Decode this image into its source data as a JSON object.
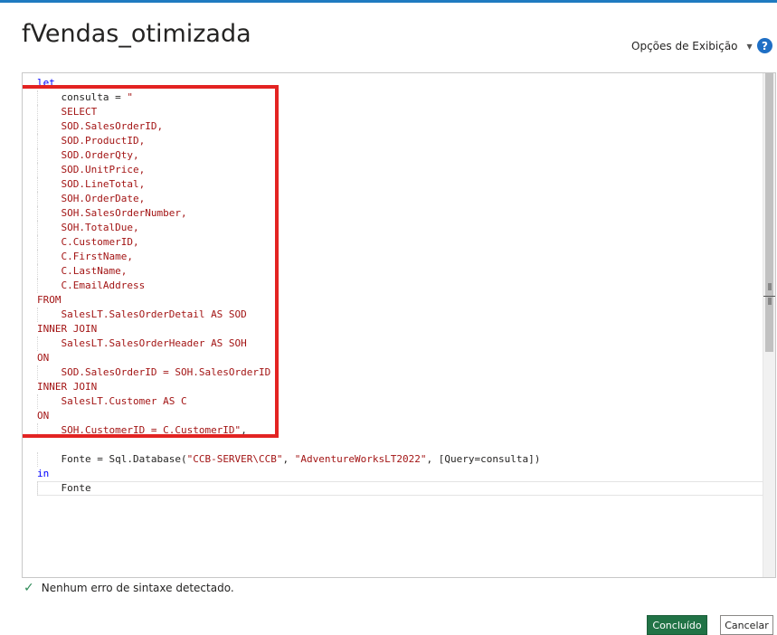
{
  "header": {
    "title": "fVendas_otimizada",
    "view_options_label": "Opções de Exibição",
    "help_label": "?"
  },
  "editor": {
    "lines": [
      {
        "indent": 0,
        "parts": [
          {
            "t": "kw",
            "v": "let"
          }
        ]
      },
      {
        "indent": 1,
        "parts": [
          {
            "t": "tx",
            "v": "consulta = "
          },
          {
            "t": "str",
            "v": "\""
          }
        ]
      },
      {
        "indent": 1,
        "parts": [
          {
            "t": "str",
            "v": "SELECT"
          }
        ]
      },
      {
        "indent": 1,
        "parts": [
          {
            "t": "str",
            "v": "SOD.SalesOrderID,"
          }
        ]
      },
      {
        "indent": 1,
        "parts": [
          {
            "t": "str",
            "v": "SOD.ProductID,"
          }
        ]
      },
      {
        "indent": 1,
        "parts": [
          {
            "t": "str",
            "v": "SOD.OrderQty,"
          }
        ]
      },
      {
        "indent": 1,
        "parts": [
          {
            "t": "str",
            "v": "SOD.UnitPrice,"
          }
        ]
      },
      {
        "indent": 1,
        "parts": [
          {
            "t": "str",
            "v": "SOD.LineTotal,"
          }
        ]
      },
      {
        "indent": 1,
        "parts": [
          {
            "t": "str",
            "v": "SOH.OrderDate,"
          }
        ]
      },
      {
        "indent": 1,
        "parts": [
          {
            "t": "str",
            "v": "SOH.SalesOrderNumber,"
          }
        ]
      },
      {
        "indent": 1,
        "parts": [
          {
            "t": "str",
            "v": "SOH.TotalDue,"
          }
        ]
      },
      {
        "indent": 1,
        "parts": [
          {
            "t": "str",
            "v": "C.CustomerID,"
          }
        ]
      },
      {
        "indent": 1,
        "parts": [
          {
            "t": "str",
            "v": "C.FirstName,"
          }
        ]
      },
      {
        "indent": 1,
        "parts": [
          {
            "t": "str",
            "v": "C.LastName,"
          }
        ]
      },
      {
        "indent": 1,
        "parts": [
          {
            "t": "str",
            "v": "C.EmailAddress"
          }
        ]
      },
      {
        "indent": 0,
        "parts": [
          {
            "t": "str",
            "v": "FROM"
          }
        ]
      },
      {
        "indent": 1,
        "parts": [
          {
            "t": "str",
            "v": "SalesLT.SalesOrderDetail AS SOD"
          }
        ]
      },
      {
        "indent": 0,
        "parts": [
          {
            "t": "str",
            "v": "INNER JOIN"
          }
        ]
      },
      {
        "indent": 1,
        "parts": [
          {
            "t": "str",
            "v": "SalesLT.SalesOrderHeader AS SOH"
          }
        ]
      },
      {
        "indent": 0,
        "parts": [
          {
            "t": "str",
            "v": "ON"
          }
        ]
      },
      {
        "indent": 1,
        "parts": [
          {
            "t": "str",
            "v": "SOD.SalesOrderID = SOH.SalesOrderID"
          }
        ]
      },
      {
        "indent": 0,
        "parts": [
          {
            "t": "str",
            "v": "INNER JOIN"
          }
        ]
      },
      {
        "indent": 1,
        "parts": [
          {
            "t": "str",
            "v": "SalesLT.Customer AS C"
          }
        ]
      },
      {
        "indent": 0,
        "parts": [
          {
            "t": "str",
            "v": "ON"
          }
        ]
      },
      {
        "indent": 1,
        "parts": [
          {
            "t": "str",
            "v": "SOH.CustomerID = C.CustomerID\""
          },
          {
            "t": "tx",
            "v": ","
          }
        ]
      },
      {
        "indent": 0,
        "parts": []
      },
      {
        "indent": 1,
        "parts": [
          {
            "t": "tx",
            "v": "Fonte = Sql.Database("
          },
          {
            "t": "str",
            "v": "\"CCB-SERVER\\CCB\""
          },
          {
            "t": "tx",
            "v": ", "
          },
          {
            "t": "str",
            "v": "\"AdventureWorksLT2022\""
          },
          {
            "t": "tx",
            "v": ", [Query=consulta])"
          }
        ]
      },
      {
        "indent": 0,
        "parts": [
          {
            "t": "kw",
            "v": "in"
          }
        ]
      },
      {
        "indent": 1,
        "parts": [
          {
            "t": "tx",
            "v": "Fonte"
          }
        ]
      }
    ]
  },
  "status": {
    "message": "Nenhum erro de sintaxe detectado."
  },
  "footer": {
    "done_label": "Concluído",
    "cancel_label": "Cancelar"
  },
  "colors": {
    "accent": "#1f7ac0",
    "primary_button": "#217346",
    "highlight_box": "#e32322",
    "keyword": "#0000ff",
    "string": "#a31515"
  }
}
